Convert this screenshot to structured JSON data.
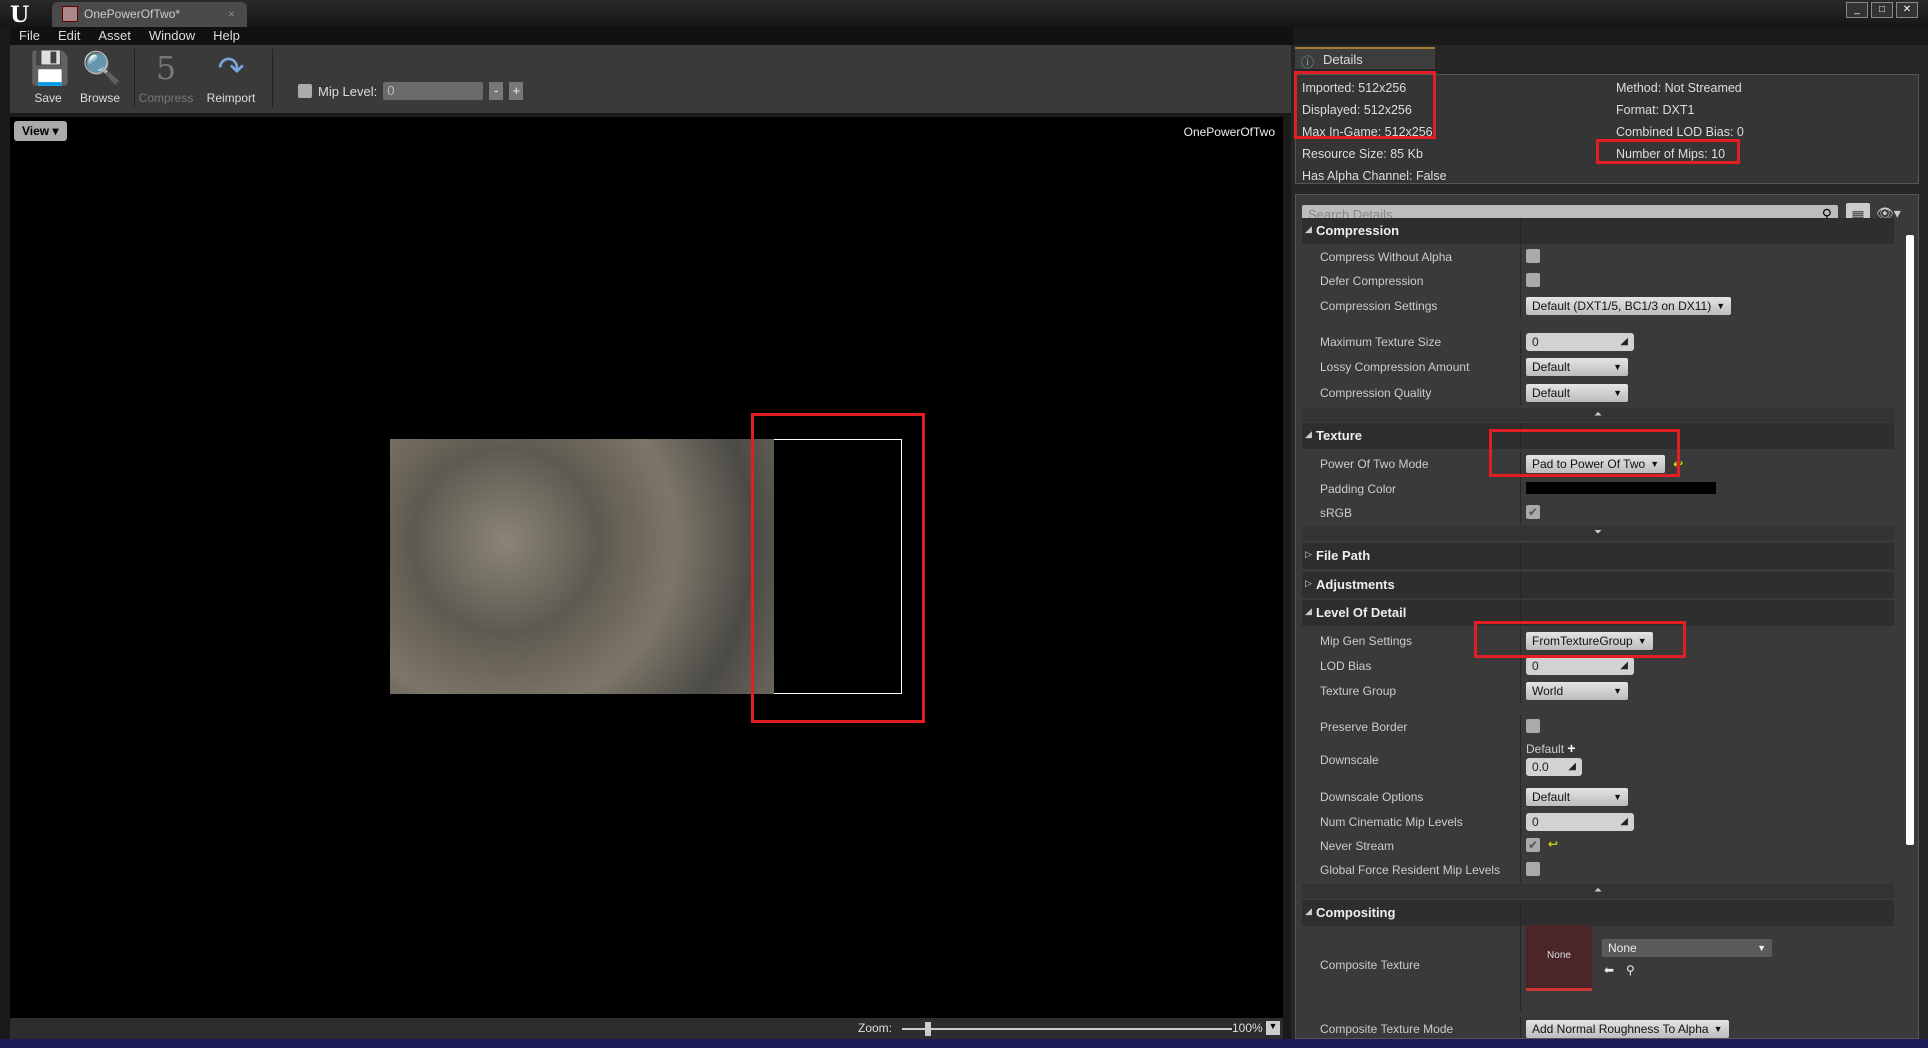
{
  "window": {
    "tab_title": "OnePowerOfTwo*",
    "logo": "U"
  },
  "menu": [
    "File",
    "Edit",
    "Asset",
    "Window",
    "Help"
  ],
  "toolbar": {
    "save": "Save",
    "browse": "Browse",
    "compress": "Compress",
    "reimport": "Reimport",
    "mip_level_label": "Mip Level:",
    "mip_level_value": "0",
    "minus": "-",
    "plus": "+"
  },
  "viewport": {
    "view_button": "View",
    "asset_label": "OnePowerOfTwo",
    "zoom_label": "Zoom:",
    "zoom_value": "100%",
    "zoom_fraction": 0.07
  },
  "details": {
    "tab": "Details",
    "info_left": [
      "Imported: 512x256",
      "Displayed: 512x256",
      "Max In-Game: 512x256",
      "Resource Size: 85 Kb",
      "Has Alpha Channel: False"
    ],
    "info_right": [
      "Method: Not Streamed",
      "Format: DXT1",
      "Combined LOD Bias: 0",
      "Number of Mips: 10"
    ],
    "search_placeholder": "Search Details",
    "rows": [
      {
        "type": "header",
        "label": "Compression",
        "expanded": true
      },
      {
        "type": "check",
        "label": "Compress Without Alpha",
        "checked": false
      },
      {
        "type": "check",
        "label": "Defer Compression",
        "checked": false
      },
      {
        "type": "dropdown",
        "label": "Compression Settings",
        "value": "Default (DXT1/5, BC1/3 on DX11)"
      },
      {
        "type": "number",
        "label": "Maximum Texture Size",
        "value": "0"
      },
      {
        "type": "dropdown",
        "label": "Lossy Compression Amount",
        "value": "Default"
      },
      {
        "type": "dropdown",
        "label": "Compression Quality",
        "value": "Default"
      },
      {
        "type": "arrow",
        "icon": "collapse-up"
      },
      {
        "type": "header",
        "label": "Texture",
        "expanded": true
      },
      {
        "type": "dropdown",
        "label": "Power Of Two Mode",
        "value": "Pad to Power Of Two",
        "reset": true
      },
      {
        "type": "color",
        "label": "Padding Color",
        "value": "#000000"
      },
      {
        "type": "check",
        "label": "sRGB",
        "checked": true
      },
      {
        "type": "arrow",
        "icon": "expand-down"
      },
      {
        "type": "header",
        "label": "File Path",
        "expanded": false
      },
      {
        "type": "header",
        "label": "Adjustments",
        "expanded": false
      },
      {
        "type": "header",
        "label": "Level Of Detail",
        "expanded": true
      },
      {
        "type": "dropdown",
        "label": "Mip Gen Settings",
        "value": "FromTextureGroup"
      },
      {
        "type": "number",
        "label": "LOD Bias",
        "value": "0"
      },
      {
        "type": "dropdown",
        "label": "Texture Group",
        "value": "World"
      },
      {
        "type": "check",
        "label": "Preserve Border",
        "checked": false
      },
      {
        "type": "downscale",
        "label": "Downscale",
        "sub": "Default",
        "value": "0.0"
      },
      {
        "type": "dropdown",
        "label": "Downscale Options",
        "value": "Default"
      },
      {
        "type": "number",
        "label": "Num Cinematic Mip Levels",
        "value": "0"
      },
      {
        "type": "check",
        "label": "Never Stream",
        "checked": true,
        "reset": true
      },
      {
        "type": "check",
        "label": "Global Force Resident Mip Levels",
        "checked": false
      },
      {
        "type": "arrow",
        "icon": "collapse-up"
      },
      {
        "type": "header",
        "label": "Compositing",
        "expanded": true
      },
      {
        "type": "composite",
        "label": "Composite Texture",
        "thumb": "None",
        "value": "None"
      },
      {
        "type": "dropdown",
        "label": "Composite Texture Mode",
        "value": "Add Normal Roughness To Alpha"
      }
    ]
  },
  "colors": {
    "highlight": "#e01e24",
    "accent": "#a07e2d"
  }
}
